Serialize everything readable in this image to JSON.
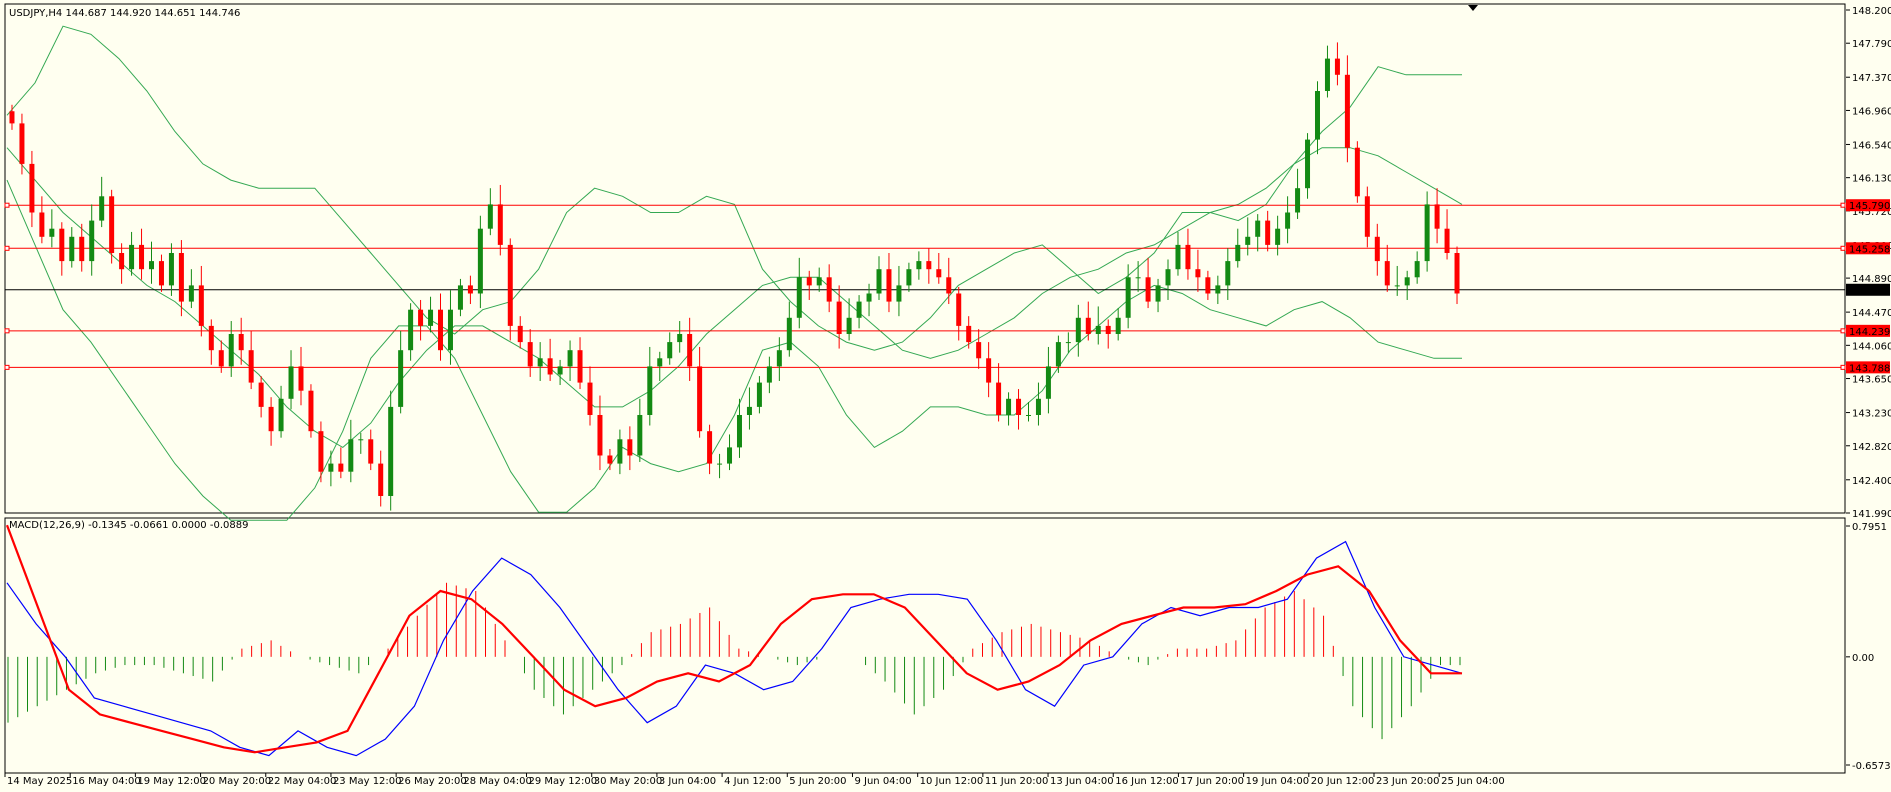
{
  "title": "USDJPY,H4  144.687 144.920 144.651 144.746",
  "macd_label": "MACD(12,26,9) -0.1345 -0.0661 0.0000 -0.0889",
  "colors": {
    "background": "#fffff0",
    "bull": "#138a13",
    "bear": "#ff0000",
    "bands": "#34a853",
    "macd_line": "#0000ff",
    "signal_line": "#ff0000",
    "level_line": "#ff0000",
    "current_line": "#000000"
  },
  "price_axis": {
    "min": 141.99,
    "max": 148.2,
    "ticks": [
      "148.200",
      "147.790",
      "147.370",
      "146.960",
      "146.540",
      "146.130",
      "145.720",
      "145.300",
      "144.890",
      "144.470",
      "144.060",
      "143.650",
      "143.230",
      "142.820",
      "142.400",
      "141.990"
    ]
  },
  "macd_axis": {
    "min": -0.6573,
    "max": 0.7951,
    "ticks": [
      "0.7951",
      "0.00",
      "-0.6573"
    ]
  },
  "levels": [
    {
      "value": 145.79,
      "label": "145.790"
    },
    {
      "value": 145.258,
      "label": "145.258"
    },
    {
      "value": 144.239,
      "label": "144.239"
    },
    {
      "value": 143.788,
      "label": "143.788"
    }
  ],
  "current_price": {
    "value": 144.746,
    "label": "144.746"
  },
  "time_labels": [
    "14 May 2025",
    "16 May 04:00",
    "19 May 12:00",
    "20 May 20:00",
    "22 May 04:00",
    "23 May 12:00",
    "26 May 20:00",
    "28 May 04:00",
    "29 May 12:00",
    "30 May 20:00",
    "3 Jun 04:00",
    "4 Jun 12:00",
    "5 Jun 20:00",
    "9 Jun 04:00",
    "10 Jun 12:00",
    "11 Jun 20:00",
    "13 Jun 04:00",
    "16 Jun 12:00",
    "17 Jun 20:00",
    "19 Jun 04:00",
    "20 Jun 12:00",
    "23 Jun 20:00",
    "25 Jun 04:00"
  ],
  "chart_data": {
    "type": "candlestick",
    "symbol": "USDJPY",
    "timeframe": "H4",
    "close_path": [
      146.8,
      146.3,
      145.7,
      145.4,
      145.5,
      145.1,
      145.4,
      145.1,
      145.6,
      145.9,
      145.2,
      145.0,
      145.3,
      145.0,
      145.1,
      144.8,
      145.2,
      144.6,
      144.8,
      144.3,
      144.0,
      143.8,
      144.2,
      144.0,
      143.6,
      143.3,
      143.0,
      143.4,
      143.8,
      143.5,
      143.0,
      142.5,
      142.6,
      142.5,
      142.9,
      142.9,
      142.6,
      142.2,
      143.3,
      144.0,
      144.5,
      144.3,
      144.5,
      144.0,
      144.5,
      144.8,
      144.7,
      145.5,
      145.8,
      145.3,
      144.3,
      144.1,
      143.8,
      143.9,
      143.7,
      143.8,
      144.0,
      143.6,
      143.2,
      142.7,
      142.6,
      142.9,
      142.7,
      143.2,
      143.8,
      143.9,
      144.1,
      144.2,
      143.8,
      143.0,
      142.6,
      142.6,
      142.8,
      143.2,
      143.3,
      143.6,
      143.8,
      144.0,
      144.4,
      144.9,
      144.8,
      144.9,
      144.6,
      144.2,
      144.4,
      144.6,
      144.7,
      145.0,
      144.6,
      144.8,
      145.0,
      145.1,
      145.0,
      144.9,
      144.7,
      144.3,
      144.1,
      143.9,
      143.6,
      143.2,
      143.4,
      143.2,
      143.2,
      143.4,
      143.8,
      144.1,
      144.1,
      144.4,
      144.2,
      144.3,
      144.2,
      144.4,
      144.9,
      144.9,
      144.6,
      144.8,
      145.0,
      145.3,
      145.0,
      144.9,
      144.7,
      144.8,
      145.1,
      145.3,
      145.4,
      145.6,
      145.3,
      145.5,
      145.7,
      146.0,
      146.6,
      147.2,
      147.6,
      147.4,
      146.5,
      145.9,
      145.4,
      145.1,
      144.8,
      144.8,
      144.9,
      145.1,
      145.8,
      145.5,
      145.2,
      144.7
    ],
    "bb_upper_path": [
      146.9,
      147.3,
      148.0,
      147.9,
      147.6,
      147.2,
      146.7,
      146.3,
      146.1,
      146.0,
      146.0,
      146.0,
      145.6,
      145.2,
      144.8,
      144.4,
      144.2,
      144.5,
      144.6,
      145.0,
      145.7,
      146.0,
      145.9,
      145.7,
      145.7,
      145.9,
      145.8,
      145.0,
      144.6,
      144.3,
      144.1,
      144.0,
      144.1,
      144.4,
      144.8,
      145.0,
      145.2,
      145.3,
      145.0,
      144.7,
      144.9,
      145.2,
      145.7,
      145.7,
      145.6,
      145.8,
      146.3,
      146.7,
      147.0,
      147.5,
      147.4,
      147.4,
      147.4
    ],
    "bb_middle_path": [
      146.5,
      146.1,
      145.7,
      145.4,
      145.1,
      144.8,
      144.6,
      144.3,
      144.0,
      143.7,
      143.3,
      143.0,
      142.8,
      143.1,
      143.6,
      144.0,
      144.3,
      144.3,
      144.1,
      143.9,
      143.6,
      143.3,
      143.3,
      143.5,
      143.8,
      144.2,
      144.5,
      144.8,
      144.9,
      144.9,
      144.6,
      144.3,
      144.0,
      143.9,
      144.0,
      144.2,
      144.4,
      144.7,
      144.9,
      145.0,
      145.2,
      145.3,
      145.5,
      145.7,
      145.8,
      146.0,
      146.3,
      146.5,
      146.5,
      146.4,
      146.2,
      146.0,
      145.8
    ],
    "bb_lower_path": [
      146.1,
      145.3,
      144.5,
      144.1,
      143.6,
      143.1,
      142.6,
      142.2,
      141.9,
      141.9,
      141.9,
      142.3,
      143.0,
      143.9,
      144.3,
      144.3,
      143.9,
      143.2,
      142.5,
      142.0,
      142.0,
      142.3,
      142.8,
      142.6,
      142.5,
      142.6,
      143.2,
      144.0,
      144.1,
      143.8,
      143.2,
      142.8,
      143.0,
      143.3,
      143.3,
      143.2,
      143.2,
      143.5,
      144.0,
      144.3,
      144.6,
      144.8,
      144.7,
      144.5,
      144.4,
      144.3,
      144.5,
      144.6,
      144.4,
      144.1,
      144.0,
      143.9,
      143.9
    ],
    "macd_path": [
      0.45,
      0.2,
      0.0,
      -0.25,
      -0.3,
      -0.35,
      -0.4,
      -0.45,
      -0.55,
      -0.6,
      -0.45,
      -0.55,
      -0.6,
      -0.5,
      -0.3,
      0.1,
      0.4,
      0.6,
      0.5,
      0.3,
      0.05,
      -0.2,
      -0.4,
      -0.3,
      -0.05,
      -0.1,
      -0.2,
      -0.15,
      0.05,
      0.3,
      0.35,
      0.38,
      0.38,
      0.35,
      0.1,
      -0.2,
      -0.3,
      -0.05,
      0.0,
      0.2,
      0.3,
      0.25,
      0.3,
      0.3,
      0.35,
      0.6,
      0.7,
      0.3,
      0.0,
      -0.05,
      -0.1
    ],
    "signal_path": [
      0.8,
      0.3,
      -0.2,
      -0.35,
      -0.4,
      -0.45,
      -0.5,
      -0.55,
      -0.58,
      -0.55,
      -0.52,
      -0.45,
      -0.1,
      0.25,
      0.4,
      0.35,
      0.2,
      0.0,
      -0.2,
      -0.3,
      -0.25,
      -0.15,
      -0.1,
      -0.15,
      -0.05,
      0.2,
      0.35,
      0.38,
      0.38,
      0.3,
      0.1,
      -0.1,
      -0.2,
      -0.15,
      -0.05,
      0.1,
      0.2,
      0.25,
      0.3,
      0.3,
      0.32,
      0.4,
      0.5,
      0.55,
      0.4,
      0.1,
      -0.1,
      -0.1
    ],
    "macd_hist_path": [
      -0.4,
      -0.3,
      -0.2,
      -0.1,
      -0.05,
      -0.05,
      -0.1,
      -0.15,
      0.05,
      0.1,
      0.0,
      -0.05,
      -0.1,
      0.05,
      0.25,
      0.45,
      0.4,
      0.1,
      -0.2,
      -0.35,
      -0.2,
      -0.05,
      0.15,
      0.2,
      0.3,
      0.05,
      0.0,
      -0.05,
      0.0,
      0.0,
      -0.15,
      -0.35,
      -0.2,
      0.05,
      0.15,
      0.2,
      0.15,
      0.1,
      0.0,
      -0.05,
      0.05,
      0.05,
      0.1,
      0.3,
      0.4,
      0.25,
      -0.3,
      -0.5,
      -0.3,
      -0.05
    ]
  }
}
